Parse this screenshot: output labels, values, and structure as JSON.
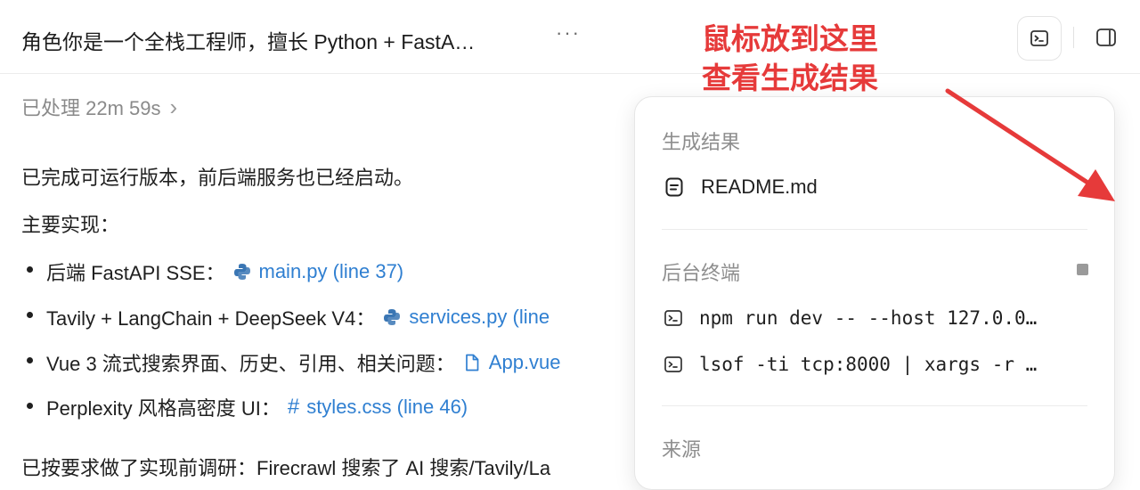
{
  "header": {
    "title": "角色你是一个全栈工程师，擅长 Python + FastA…",
    "more_label": "···"
  },
  "status": {
    "processed": "已处理 22m 59s",
    "chevron": "›"
  },
  "content": {
    "intro": "已完成可运行版本，前后端服务也已经启动。",
    "heading": "主要实现：",
    "bullets": [
      {
        "label": "后端 FastAPI SSE：",
        "icon": "python-icon",
        "link": "main.py (line 37)"
      },
      {
        "label": "Tavily + LangChain + DeepSeek V4：",
        "icon": "python-icon",
        "link": "services.py (line"
      },
      {
        "label": "Vue 3 流式搜索界面、历史、引用、相关问题：",
        "icon": "file-icon",
        "link": "App.vue"
      },
      {
        "label": "Perplexity 风格高密度 UI：",
        "icon": "hash-icon",
        "link": "styles.css (line 46)"
      }
    ],
    "footer": "已按要求做了实现前调研：Firecrawl 搜索了 AI 搜索/Tavily/La"
  },
  "popup": {
    "results_title": "生成结果",
    "results": [
      "README.md"
    ],
    "terminal_title": "后台终端",
    "commands": [
      "npm run dev -- --host 127.0.0…",
      "lsof -ti tcp:8000 | xargs -r …"
    ],
    "sources_title": "来源"
  },
  "annotation": {
    "line1": "鼠标放到这里",
    "line2": "查看生成结果"
  },
  "colors": {
    "link": "#2f7fd1",
    "annotation": "#e63a3a",
    "python_blue": "#3a76b4"
  }
}
